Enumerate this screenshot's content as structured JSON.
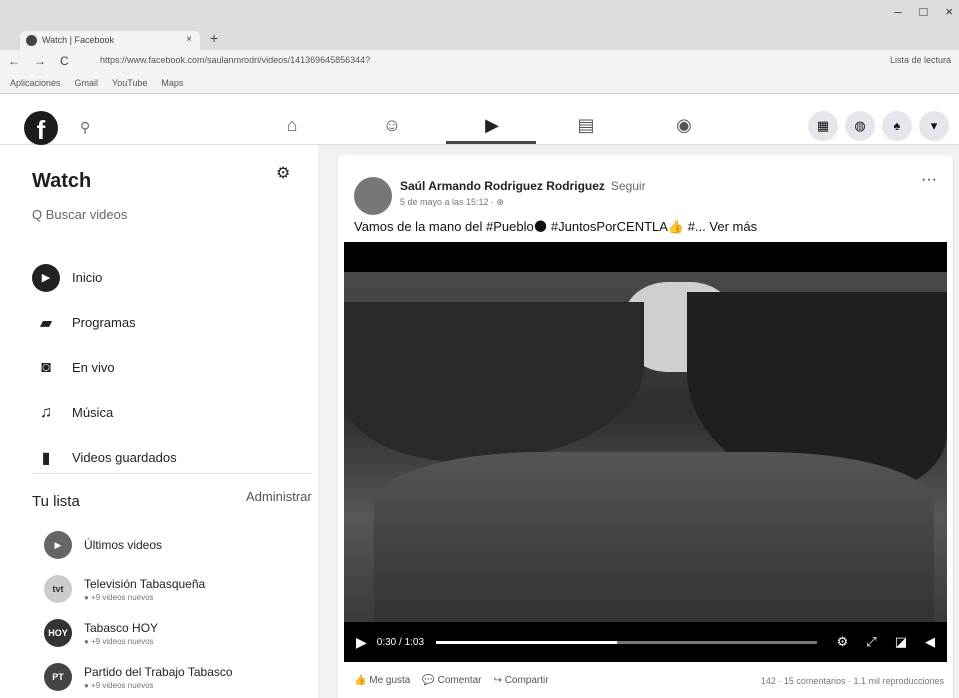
{
  "browser": {
    "tab_title": "Watch | Facebook",
    "tab_close": "×",
    "new_tab": "+",
    "url": "https://www.facebook.com/saulanmrodri/videos/141369645856344?",
    "reading_list": "Lista de lectura",
    "nav": {
      "back": "←",
      "forward": "→",
      "reload": "C"
    },
    "window_controls": {
      "minimize": "–",
      "maximize": "□",
      "close": "×"
    },
    "bookmarks": [
      "Aplicaciones",
      "Gmail",
      "YouTube",
      "Maps"
    ]
  },
  "fb": {
    "logo": "f",
    "search_icon": "⚲"
  },
  "sidebar": {
    "title": "Watch",
    "search_placeholder": "Q Buscar videos",
    "menu": [
      {
        "label": "Inicio",
        "icon": "play-icon"
      },
      {
        "label": "Programas",
        "icon": "shows-icon"
      },
      {
        "label": "En vivo",
        "icon": "live-icon"
      },
      {
        "label": "Música",
        "icon": "music-icon"
      },
      {
        "label": "Videos guardados",
        "icon": "saved-icon"
      }
    ],
    "tu_lista": "Tu lista",
    "administrar": "Administrar",
    "lista": [
      {
        "name": "Últimos videos",
        "sub": ""
      },
      {
        "name": "Televisión Tabasqueña",
        "sub": "● +9 videos nuevos",
        "avatar": "tvt"
      },
      {
        "name": "Tabasco HOY",
        "sub": "● +9 videos nuevos",
        "avatar": "HOY"
      },
      {
        "name": "Partido del Trabajo Tabasco",
        "sub": "● +9 videos nuevos",
        "avatar": "PT"
      }
    ]
  },
  "post": {
    "author": "Saúl Armando Rodriguez Rodriguez",
    "follow": "Seguir",
    "time": "5 de mayo a las 15:12 · ⊕",
    "more": "···",
    "text": "Vamos de la mano del #Pueblo🌑 #JuntosPorCENTLA👍 #... Ver más",
    "video": {
      "time": "0:30 / 1:03",
      "progress": 0.476
    },
    "actions": {
      "like": "Me gusta",
      "comment": "Comentar",
      "share": "Compartir",
      "stats": "142 · 15 comentarios · 1.1 mil reproducciones"
    }
  }
}
